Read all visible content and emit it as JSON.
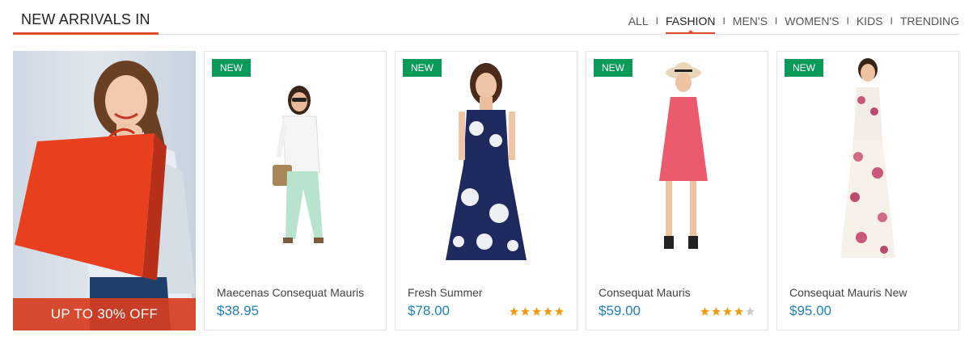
{
  "section": {
    "title": "NEW ARRIVALS IN"
  },
  "tabs": [
    {
      "label": "ALL",
      "active": false
    },
    {
      "label": "FASHION",
      "active": true
    },
    {
      "label": "MEN'S",
      "active": false
    },
    {
      "label": "WOMEN'S",
      "active": false
    },
    {
      "label": "KIDS",
      "active": false
    },
    {
      "label": "TRENDING",
      "active": false
    }
  ],
  "promo": {
    "text": "UP TO 30% OFF"
  },
  "colors": {
    "accent": "#e14d2a",
    "badge": "#0a9a5b",
    "price": "#1f7fb5",
    "star_on": "#f39c12",
    "star_off": "#cccccc"
  },
  "products": [
    {
      "badge": "NEW",
      "name": "Maecenas Consequat Mauris",
      "price": "$38.95",
      "rating": 0
    },
    {
      "badge": "NEW",
      "name": "Fresh Summer",
      "price": "$78.00",
      "rating": 5
    },
    {
      "badge": "NEW",
      "name": "Consequat Mauris",
      "price": "$59.00",
      "rating": 4
    },
    {
      "badge": "NEW",
      "name": "Consequat Mauris New",
      "price": "$95.00",
      "rating": 0
    }
  ]
}
